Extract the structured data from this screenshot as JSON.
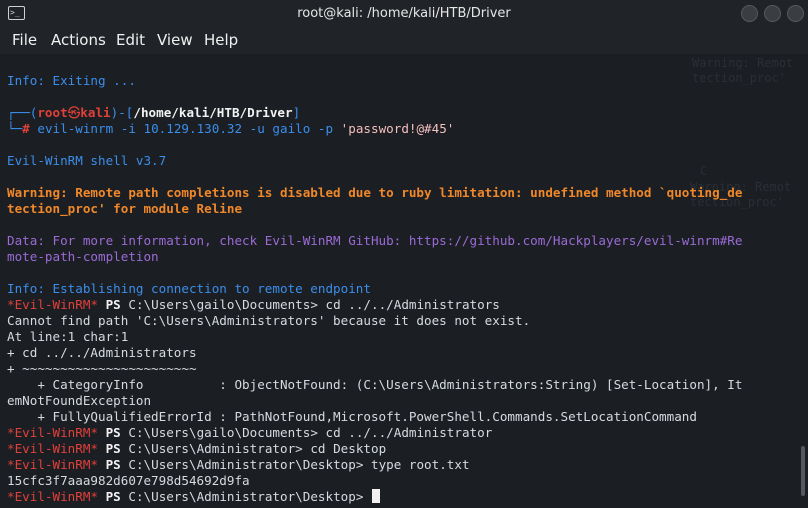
{
  "window": {
    "title": "root@kali: /home/kali/HTB/Driver"
  },
  "menu": {
    "file": "File",
    "actions": "Actions",
    "edit": "Edit",
    "view": "View",
    "help": "Help"
  },
  "terminal": {
    "info_exiting": "Info: Exiting ...",
    "prompt": {
      "open": "┌──(",
      "user": "root",
      "at": "㉿",
      "host": "kali",
      "close": ")-[",
      "path": "/home/kali/HTB/Driver",
      "end": "]",
      "corner": "└─",
      "hash": "#",
      "command": "evil-winrm",
      "args": " -i 10.129.130.32 -u gailo -p ",
      "password": "'password!@#45'"
    },
    "version": "Evil-WinRM shell v3.7",
    "warning_1": "Warning: Remote path completions is disabled due to ruby limitation: undefined method `quoting_de",
    "warning_2": "tection_proc' for module Reline",
    "data_1": "Data: For more information, check Evil-WinRM GitHub: https://github.com/Hackplayers/evil-winrm#Re",
    "data_2": "mote-path-completion",
    "info_connect": "Info: Establishing connection to remote endpoint",
    "ps_tag": "*Evil-WinRM*",
    "ps_label": "PS",
    "cmd1": "C:\\Users\\gailo\\Documents> cd ../../Administrators",
    "err1": "Cannot find path 'C:\\Users\\Administrators' because it does not exist.",
    "err2": "At line:1 char:1",
    "err3": "+ cd ../../Administrators",
    "err4": "+ ~~~~~~~~~~~~~~~~~~~~~~~",
    "err5": "    + CategoryInfo          : ObjectNotFound: (C:\\Users\\Administrators:String) [Set-Location], It",
    "err6": "emNotFoundException",
    "err7": "    + FullyQualifiedErrorId : PathNotFound,Microsoft.PowerShell.Commands.SetLocationCommand",
    "cmd2": "C:\\Users\\gailo\\Documents> cd ../../Administrator",
    "cmd3": "C:\\Users\\Administrator> cd Desktop",
    "cmd4": "C:\\Users\\Administrator\\Desktop> type root.txt",
    "flag": "15cfc3f7aaa982d607e798d54692d9fa",
    "cmd5": "C:\\Users\\Administrator\\Desktop> "
  },
  "background_text": {
    "w1": "Warning: Remot",
    "w2": "tection_proc'",
    "w3": "C",
    "w4": "Warning: Remot",
    "w5": "tection_proc'"
  },
  "colors": {
    "info": "#3b8eea",
    "warning": "#f0882a",
    "data": "#9b6bd6",
    "prompt_tag": "#e0403a",
    "path": "#4aa3d8"
  },
  "icons": {
    "terminal": "terminal-icon",
    "minimize": "minimize-icon",
    "maximize": "maximize-icon",
    "close": "close-icon"
  }
}
